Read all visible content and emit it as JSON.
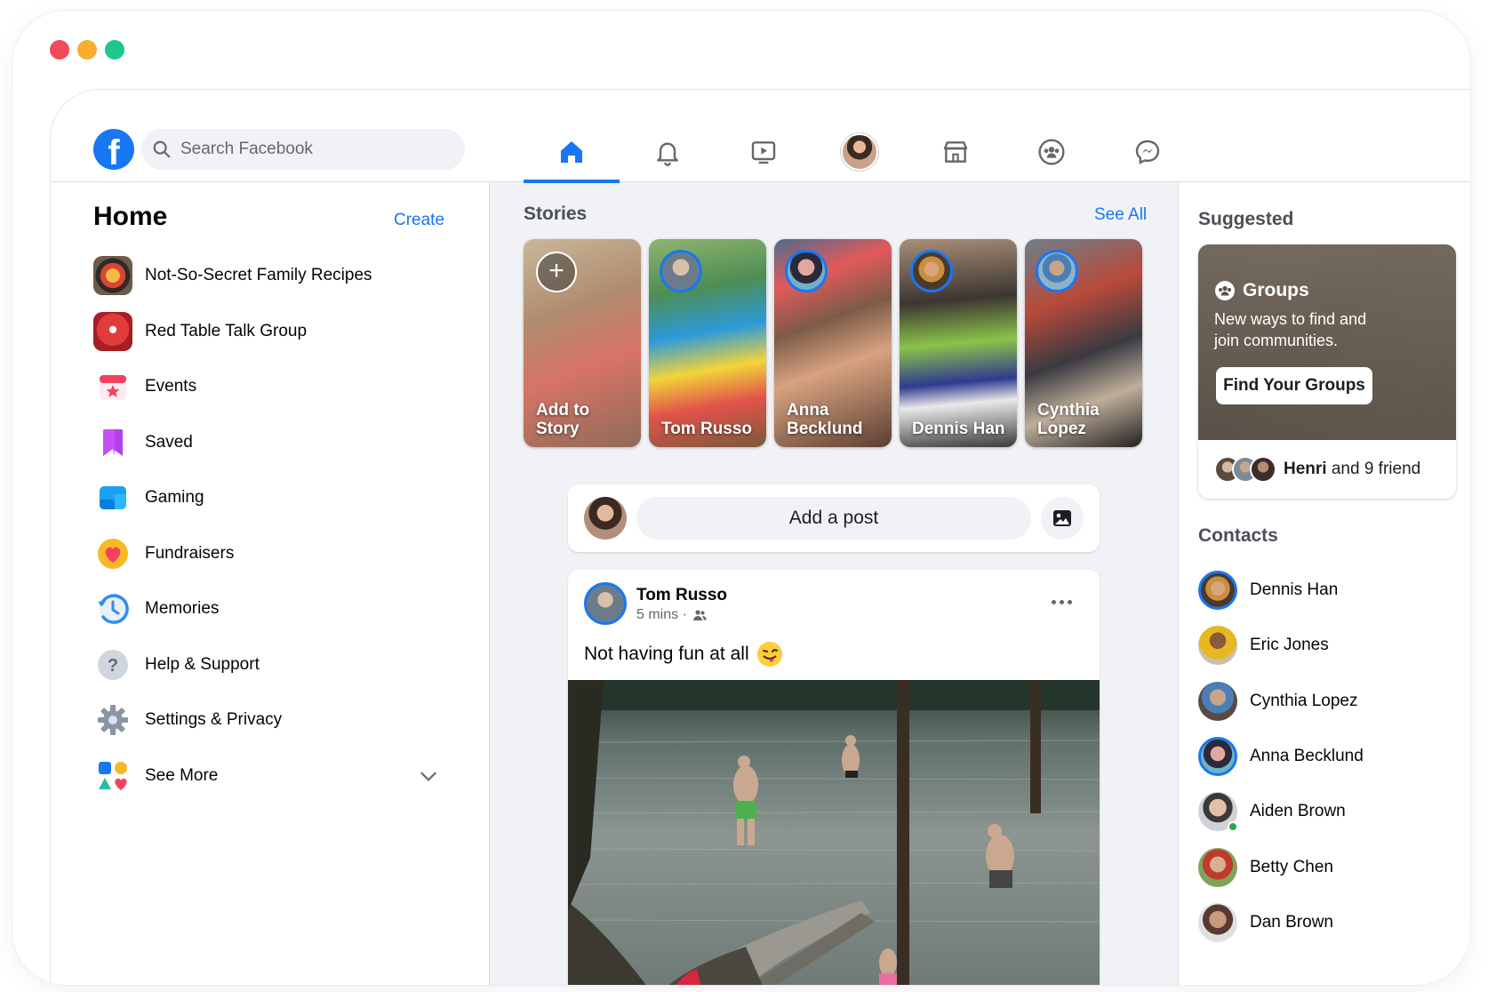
{
  "search": {
    "placeholder": "Search Facebook"
  },
  "nav": {
    "items": [
      {
        "name": "home",
        "icon": "home-icon",
        "active": true
      },
      {
        "name": "notifications",
        "icon": "bell-icon"
      },
      {
        "name": "watch",
        "icon": "video-play-icon"
      },
      {
        "name": "profile",
        "icon": "profile-avatar"
      },
      {
        "name": "marketplace",
        "icon": "store-icon"
      },
      {
        "name": "groups",
        "icon": "groups-icon"
      },
      {
        "name": "messenger",
        "icon": "messenger-icon"
      }
    ]
  },
  "left": {
    "title": "Home",
    "create_label": "Create",
    "menu": [
      {
        "label": "Not-So-Secret Family Recipes",
        "icon": "group-thumbnail"
      },
      {
        "label": "Red Table Talk Group",
        "icon": "group-thumbnail"
      },
      {
        "label": "Events",
        "icon": "calendar-star-icon"
      },
      {
        "label": "Saved",
        "icon": "bookmark-icon"
      },
      {
        "label": "Gaming",
        "icon": "gaming-icon"
      },
      {
        "label": "Fundraisers",
        "icon": "heart-icon"
      },
      {
        "label": "Memories",
        "icon": "clock-history-icon"
      },
      {
        "label": "Help & Support",
        "icon": "question-icon"
      },
      {
        "label": "Settings & Privacy",
        "icon": "gear-icon"
      },
      {
        "label": "See More",
        "icon": "shapes-icon"
      }
    ]
  },
  "stories": {
    "title": "Stories",
    "see_all": "See All",
    "items": [
      {
        "label": "Add to Story"
      },
      {
        "label": "Tom Russo"
      },
      {
        "label": "Anna Becklund"
      },
      {
        "label": "Dennis Han"
      },
      {
        "label": "Cynthia Lopez"
      }
    ]
  },
  "composer": {
    "placeholder": "Add a post"
  },
  "post": {
    "author": "Tom Russo",
    "time": "5 mins ·",
    "text": "Not having fun at all"
  },
  "suggested": {
    "title": "Suggested",
    "card_title": "Groups",
    "card_subtitle": "New ways to find and join communities.",
    "button": "Find Your Groups",
    "friends_name": "Henri",
    "friends_text": "and 9 friend"
  },
  "contacts": {
    "title": "Contacts",
    "items": [
      {
        "name": "Dennis Han"
      },
      {
        "name": "Eric Jones"
      },
      {
        "name": "Cynthia Lopez"
      },
      {
        "name": "Anna Becklund"
      },
      {
        "name": "Aiden Brown"
      },
      {
        "name": "Betty Chen"
      },
      {
        "name": "Dan Brown"
      }
    ]
  },
  "colors": {
    "accent": "#1877f2",
    "background": "#f0f2f5",
    "online": "#31a24c"
  }
}
